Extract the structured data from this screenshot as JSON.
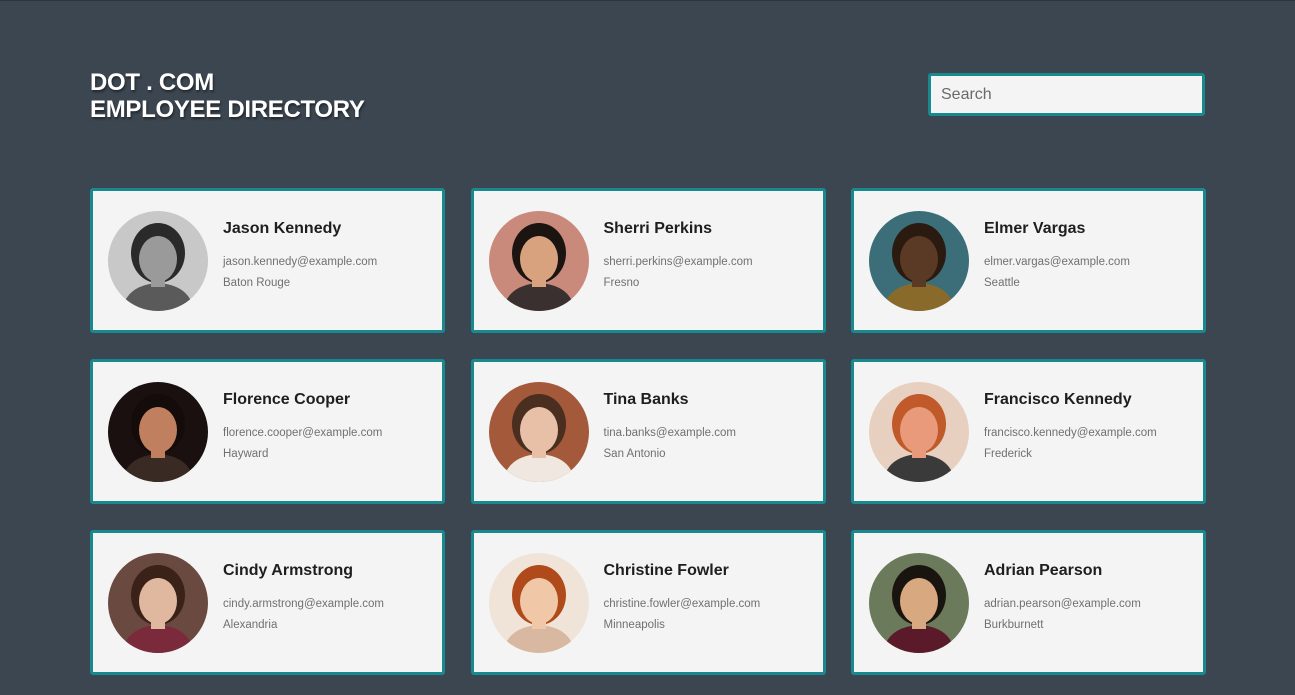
{
  "header": {
    "line1": "DOT . COM",
    "line2": "EMPLOYEE DIRECTORY"
  },
  "search": {
    "placeholder": "Search",
    "value": ""
  },
  "employees": [
    {
      "name": "Jason Kennedy",
      "email": "jason.kennedy@example.com",
      "city": "Baton Rouge",
      "avatar": {
        "bg": "#c8c8c8",
        "skin": "#9a9a9a",
        "hair": "#2a2a2a",
        "shirt": "#5a5a5a"
      }
    },
    {
      "name": "Sherri Perkins",
      "email": "sherri.perkins@example.com",
      "city": "Fresno",
      "avatar": {
        "bg": "#c98a7c",
        "skin": "#d9a27f",
        "hair": "#1c1410",
        "shirt": "#3a3030"
      }
    },
    {
      "name": "Elmer Vargas",
      "email": "elmer.vargas@example.com",
      "city": "Seattle",
      "avatar": {
        "bg": "#3c6e7a",
        "skin": "#5a3a24",
        "hair": "#2a1a10",
        "shirt": "#8a6a2a"
      }
    },
    {
      "name": "Florence Cooper",
      "email": "florence.cooper@example.com",
      "city": "Hayward",
      "avatar": {
        "bg": "#1a1010",
        "skin": "#c08060",
        "hair": "#140c0a",
        "shirt": "#3a2a24"
      }
    },
    {
      "name": "Tina Banks",
      "email": "tina.banks@example.com",
      "city": "San Antonio",
      "avatar": {
        "bg": "#a45a3a",
        "skin": "#e8c0a8",
        "hair": "#4a2e20",
        "shirt": "#f0e8e0"
      }
    },
    {
      "name": "Francisco Kennedy",
      "email": "francisco.kennedy@example.com",
      "city": "Frederick",
      "avatar": {
        "bg": "#e8d0c0",
        "skin": "#e89a7a",
        "hair": "#c05a2a",
        "shirt": "#3a3a3a"
      }
    },
    {
      "name": "Cindy Armstrong",
      "email": "cindy.armstrong@example.com",
      "city": "Alexandria",
      "avatar": {
        "bg": "#6a4a40",
        "skin": "#e0b8a0",
        "hair": "#3a2218",
        "shirt": "#7a2a3a"
      }
    },
    {
      "name": "Christine Fowler",
      "email": "christine.fowler@example.com",
      "city": "Minneapolis",
      "avatar": {
        "bg": "#f0e4d8",
        "skin": "#f0c8a8",
        "hair": "#b04a1a",
        "shirt": "#d8b8a0"
      }
    },
    {
      "name": "Adrian Pearson",
      "email": "adrian.pearson@example.com",
      "city": "Burkburnett",
      "avatar": {
        "bg": "#6a7a5a",
        "skin": "#d8a880",
        "hair": "#1a1410",
        "shirt": "#5a1a2a"
      }
    }
  ]
}
